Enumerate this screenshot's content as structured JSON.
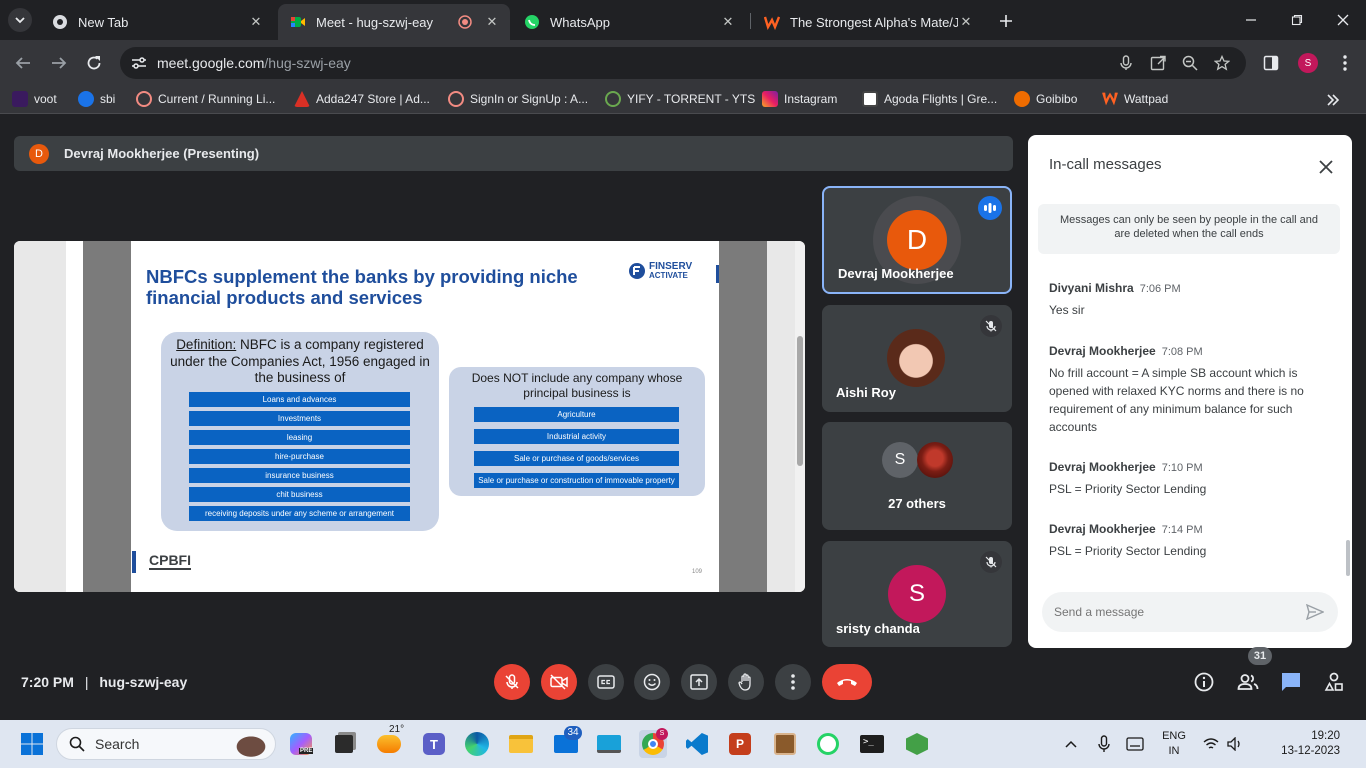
{
  "browser": {
    "tabs": [
      {
        "title": "New Tab"
      },
      {
        "title": "Meet - hug-szwj-eay"
      },
      {
        "title": "WhatsApp"
      },
      {
        "title": "The Strongest Alpha's Mate/JJK"
      }
    ],
    "url_host": "meet.google.com",
    "url_path": "/hug-szwj-eay",
    "profile_initial": "S",
    "bookmarks": [
      {
        "label": "voot"
      },
      {
        "label": "sbi"
      },
      {
        "label": "Current / Running Li..."
      },
      {
        "label": "Adda247 Store | Ad..."
      },
      {
        "label": "SignIn or SignUp : A..."
      },
      {
        "label": "YIFY - TORRENT - YTS"
      },
      {
        "label": "Instagram"
      },
      {
        "label": "Agoda Flights | Gre..."
      },
      {
        "label": "Goibibo"
      },
      {
        "label": "Wattpad"
      }
    ]
  },
  "meet": {
    "presenter_initial": "D",
    "presenter_label": "Devraj Mookherjee (Presenting)",
    "slide": {
      "title_line1": "NBFCs supplement the banks by providing niche",
      "title_line2": "financial products and services",
      "brand_top": "FINSERV",
      "brand_bottom": "ACTIVATE",
      "definition_heading": "Definition:",
      "definition_rest1": " NBFC is a company registered",
      "definition_line2": "under the Companies Act, 1956 engaged in",
      "definition_line3": "the business of",
      "includes": [
        "Loans and advances",
        "Investments",
        "leasing",
        "hire-purchase",
        "insurance business",
        "chit business",
        "receiving deposits under any scheme or arrangement"
      ],
      "excludes_heading_line1": "Does NOT include any company whose",
      "excludes_heading_line2": "principal business is",
      "excludes": [
        "Agriculture",
        "Industrial activity",
        "Sale or purchase of goods/services",
        "Sale or purchase or construction of immovable property"
      ],
      "footer_logo": "CPBFI",
      "page_number": "109"
    },
    "participants": [
      {
        "initial": "D",
        "name": "Devraj Mookherjee",
        "color": "#e8590c"
      },
      {
        "name": "Aishi Roy"
      },
      {
        "initial": "S",
        "label": "27 others"
      },
      {
        "initial": "S",
        "name": "sristy chanda",
        "color": "#c2185b"
      }
    ],
    "chat": {
      "title": "In-call messages",
      "notice": "Messages can only be seen by people in the call and are deleted when the call ends",
      "messages": [
        {
          "sender": "Divyani Mishra",
          "time": "7:06 PM",
          "text": "Yes sir"
        },
        {
          "sender": "Devraj Mookherjee",
          "time": "7:08 PM",
          "text": "No frill account = A simple SB account which is opened with relaxed KYC norms and there is no requirement of any minimum balance for such accounts"
        },
        {
          "sender": "Devraj Mookherjee",
          "time": "7:10 PM",
          "text": "PSL = Priority Sector Lending"
        },
        {
          "sender": "Devraj Mookherjee",
          "time": "7:14 PM",
          "text": "PSL = Priority Sector Lending"
        }
      ],
      "input_placeholder": "Send a message"
    },
    "time": "7:20 PM",
    "separator": "|",
    "meeting_code": "hug-szwj-eay",
    "people_count": "31"
  },
  "taskbar": {
    "search_placeholder": "Search",
    "weather_temp": "21°",
    "mail_badge": "34",
    "language": "ENG",
    "region": "IN",
    "clock_time": "19:20",
    "clock_date": "13-12-2023",
    "chrome_badge": "S"
  }
}
